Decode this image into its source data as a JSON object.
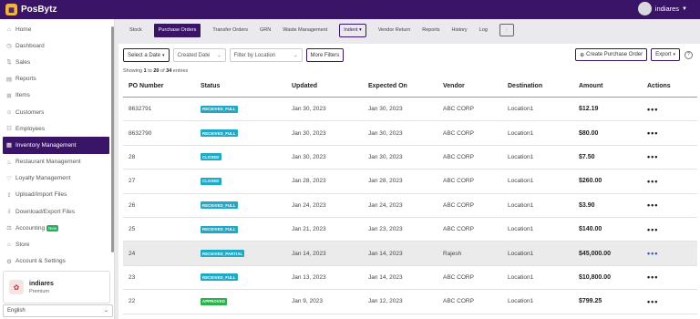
{
  "app": {
    "name": "PosBytz",
    "user": "indiares"
  },
  "sidebar": {
    "items": [
      {
        "label": "Home",
        "icon": "home-icon",
        "glyph": "⌂"
      },
      {
        "label": "Dashboard",
        "icon": "dashboard-icon",
        "glyph": "◷"
      },
      {
        "label": "Sales",
        "icon": "sales-icon",
        "glyph": "⇅"
      },
      {
        "label": "Reports",
        "icon": "reports-icon",
        "glyph": "▤"
      },
      {
        "label": "Items",
        "icon": "items-icon",
        "glyph": "⊞"
      },
      {
        "label": "Customers",
        "icon": "customers-icon",
        "glyph": "☺"
      },
      {
        "label": "Employees",
        "icon": "employees-icon",
        "glyph": "☷"
      },
      {
        "label": "Inventory Management",
        "icon": "inventory-icon",
        "glyph": "▦",
        "active": true
      },
      {
        "label": "Restaurant Management",
        "icon": "restaurant-icon",
        "glyph": "♨"
      },
      {
        "label": "Loyalty Management",
        "icon": "loyalty-icon",
        "glyph": "♡"
      },
      {
        "label": "Upload/Import Files",
        "icon": "upload-icon",
        "glyph": "⇪"
      },
      {
        "label": "Download/Export Files",
        "icon": "download-icon",
        "glyph": "⤓"
      },
      {
        "label": "Accounting",
        "icon": "accounting-icon",
        "glyph": "⚖",
        "badge": "New"
      },
      {
        "label": "Store",
        "icon": "store-icon",
        "glyph": "⌂"
      },
      {
        "label": "Account & Settings",
        "icon": "settings-icon",
        "glyph": "⚙"
      }
    ]
  },
  "profile": {
    "name": "indiares",
    "plan": "Premium"
  },
  "language": {
    "value": "English"
  },
  "tabs": [
    {
      "label": "Stock",
      "style": ""
    },
    {
      "label": "Purchase Orders",
      "style": "active"
    },
    {
      "label": "Transfer Orders",
      "style": ""
    },
    {
      "label": "GRN",
      "style": ""
    },
    {
      "label": "Waste Management",
      "style": ""
    },
    {
      "label": "Indent ▾",
      "style": "outlined"
    },
    {
      "label": "Vendor Return",
      "style": ""
    },
    {
      "label": "Reports",
      "style": ""
    },
    {
      "label": "History",
      "style": ""
    },
    {
      "label": "Log",
      "style": ""
    },
    {
      "label": "⋮",
      "style": "empty"
    }
  ],
  "filters": {
    "date": "Select a Date",
    "created": "Created Date",
    "location_placeholder": "Filter by Location",
    "more": "More Filters"
  },
  "tools": {
    "create": "Create Purchase Order",
    "export": "Export",
    "help": "?"
  },
  "count": {
    "prefix": "Showing ",
    "from": "1",
    "mid": " to ",
    "to": "20",
    "of": " of ",
    "total": "34",
    "suffix": " entries"
  },
  "table": {
    "headers": [
      "PO Number",
      "Status",
      "Updated",
      "Expected On",
      "Vendor",
      "Destination",
      "Amount",
      "Actions"
    ],
    "rows": [
      {
        "po": "8632791",
        "status": "RECEIVED_FULL",
        "color": "blue",
        "updated": "Jan 30, 2023",
        "expected": "Jan 30, 2023",
        "vendor": "ABC CORP",
        "dest": "Location1",
        "amount": "$12.19"
      },
      {
        "po": "8632790",
        "status": "RECEIVED_FULL",
        "color": "blue",
        "updated": "Jan 30, 2023",
        "expected": "Jan 30, 2023",
        "vendor": "ABC CORP",
        "dest": "Location1",
        "amount": "$80.00"
      },
      {
        "po": "28",
        "status": "CLOSED",
        "color": "blue",
        "updated": "Jan 30, 2023",
        "expected": "Jan 30, 2023",
        "vendor": "ABC CORP",
        "dest": "Location1",
        "amount": "$7.50"
      },
      {
        "po": "27",
        "status": "CLOSED",
        "color": "blue",
        "updated": "Jan 28, 2023",
        "expected": "Jan 28, 2023",
        "vendor": "ABC CORP",
        "dest": "Location1",
        "amount": "$260.00"
      },
      {
        "po": "26",
        "status": "RECEIVED_FULL",
        "color": "blue",
        "updated": "Jan 24, 2023",
        "expected": "Jan 24, 2023",
        "vendor": "ABC CORP",
        "dest": "Location1",
        "amount": "$3.90"
      },
      {
        "po": "25",
        "status": "RECEIVED_FULL",
        "color": "blue",
        "updated": "Jan 21, 2023",
        "expected": "Jan 23, 2023",
        "vendor": "ABC CORP",
        "dest": "Location1",
        "amount": "$140.00"
      },
      {
        "po": "24",
        "status": "RECEIVED_PARTIAL",
        "color": "blue",
        "updated": "Jan 14, 2023",
        "expected": "Jan 14, 2023",
        "vendor": "Rajesh",
        "dest": "Location1",
        "amount": "$45,000.00",
        "highlight": true
      },
      {
        "po": "23",
        "status": "RECEIVED_FULL",
        "color": "blue",
        "updated": "Jan 13, 2023",
        "expected": "Jan 14, 2023",
        "vendor": "ABC CORP",
        "dest": "Location1",
        "amount": "$10,800.00"
      },
      {
        "po": "22",
        "status": "APPROVED",
        "color": "green",
        "updated": "Jan 9, 2023",
        "expected": "Jan 12, 2023",
        "vendor": "ABC CORP",
        "dest": "Location1",
        "amount": "$799.25"
      }
    ]
  }
}
